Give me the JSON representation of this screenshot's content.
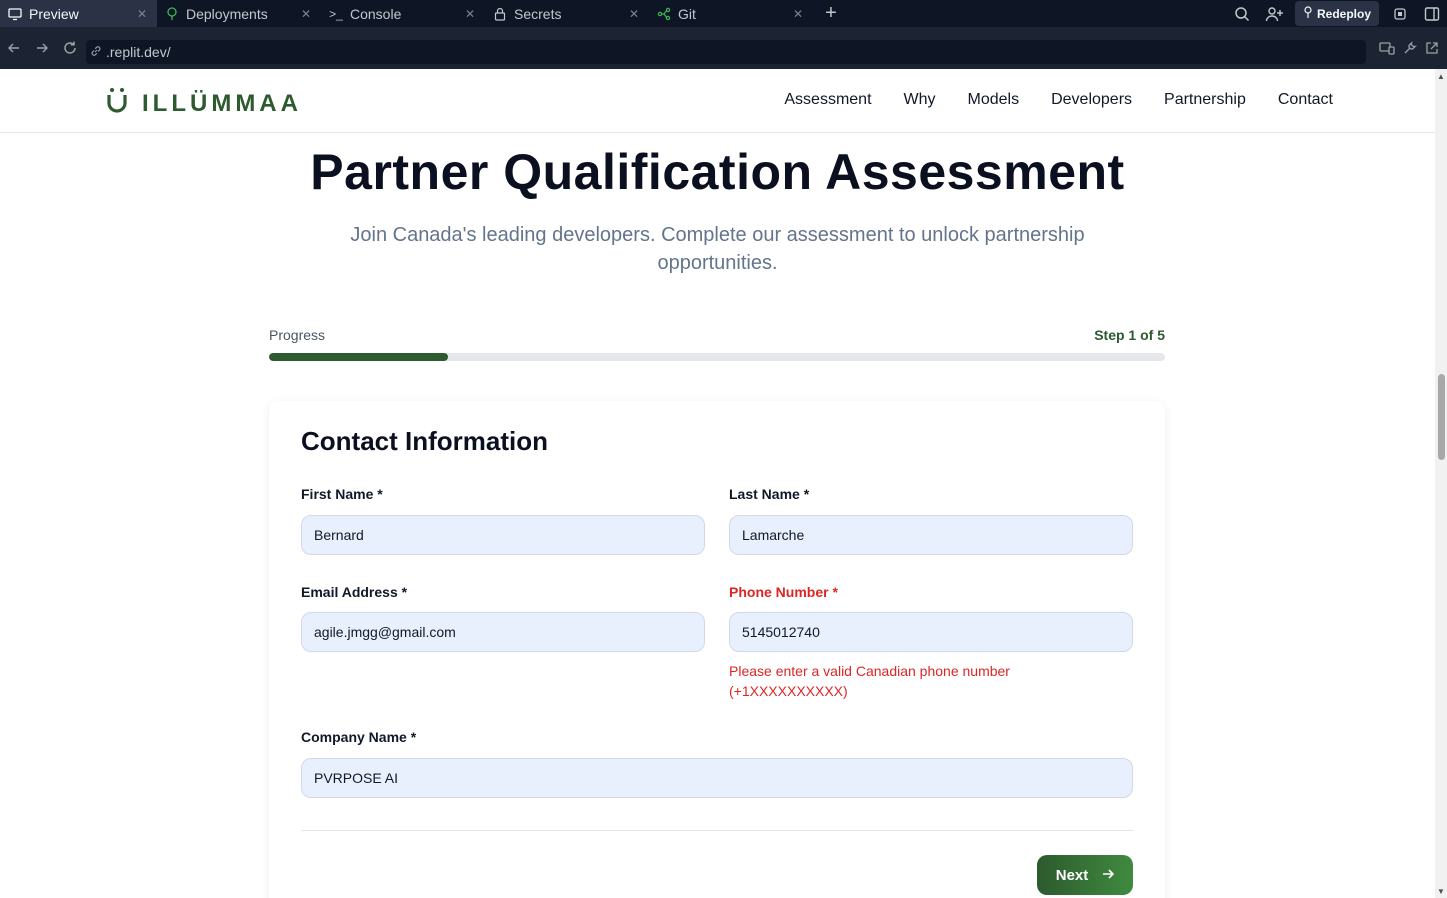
{
  "browser": {
    "tabs": [
      {
        "label": "Preview",
        "icon": "monitor-icon",
        "active": true
      },
      {
        "label": "Deployments",
        "icon": "deployments-icon",
        "active": false
      },
      {
        "label": "Console",
        "icon": "terminal-icon",
        "active": false
      },
      {
        "label": "Secrets",
        "icon": "lock-icon",
        "active": false
      },
      {
        "label": "Git",
        "icon": "git-icon",
        "active": false
      }
    ],
    "redeploy_label": "Redeploy",
    "url": ".replit.dev/"
  },
  "site": {
    "logo_text": "ILLÜMMAA",
    "nav": [
      "Assessment",
      "Why",
      "Models",
      "Developers",
      "Partnership",
      "Contact"
    ]
  },
  "hero": {
    "title": "Partner Qualification Assessment",
    "subtitle": "Join Canada's leading developers. Complete our assessment to unlock partnership opportunities."
  },
  "progress": {
    "label": "Progress",
    "step_text": "Step 1 of 5",
    "fraction": 0.2
  },
  "form": {
    "section_title": "Contact Information",
    "first_name": {
      "label": "First Name *",
      "value": "Bernard"
    },
    "last_name": {
      "label": "Last Name *",
      "value": "Lamarche"
    },
    "email": {
      "label": "Email Address *",
      "value": "agile.jmgg@gmail.com"
    },
    "phone": {
      "label": "Phone Number *",
      "value": "5145012740",
      "error": "Please enter a valid Canadian phone number (+1XXXXXXXXXX)"
    },
    "company": {
      "label": "Company Name *",
      "value": "PVRPOSE AI"
    },
    "next_label": "Next"
  },
  "colors": {
    "brand_green": "#2d5a2e",
    "error_red": "#dc2626",
    "input_bg": "#e8f0fe"
  }
}
